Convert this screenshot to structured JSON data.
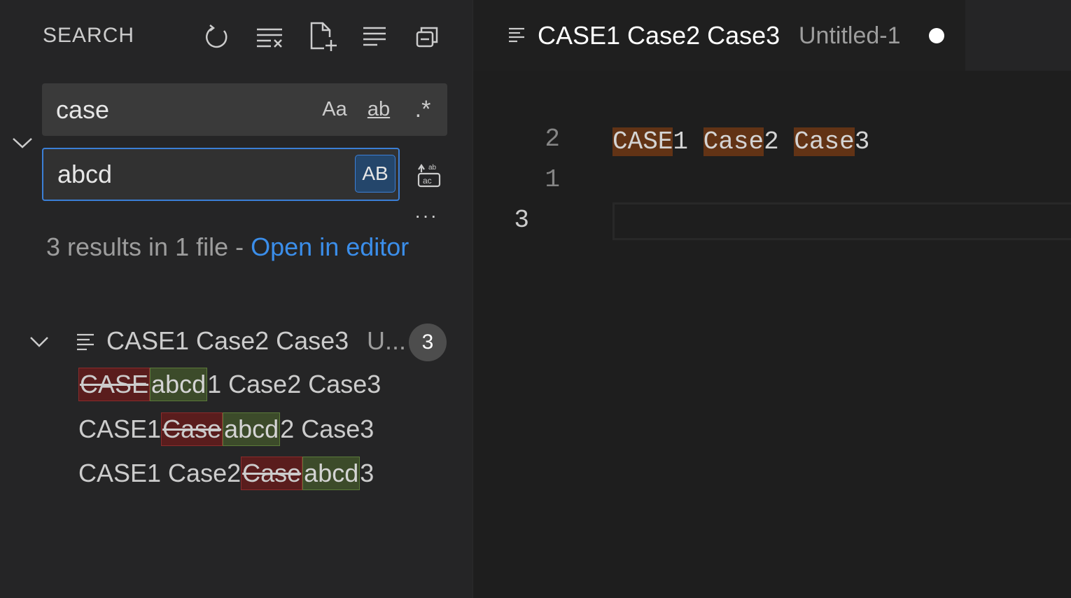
{
  "sidebar": {
    "title": "SEARCH",
    "toolbar": {
      "refresh": "refresh-icon",
      "clear": "clear-results-icon",
      "new_search_editor": "new-search-editor-icon",
      "view_as_tree": "view-as-list-icon",
      "collapse_all": "collapse-all-icon"
    },
    "search": {
      "value": "case",
      "match_case_label": "Aa",
      "whole_word_label": "ab",
      "regex_label": ".*"
    },
    "replace": {
      "value": "abcd",
      "preserve_case_label": "AB"
    },
    "more_label": "···",
    "summary": {
      "text": "3 results in 1 file - ",
      "link": "Open in editor"
    },
    "results": {
      "file_name": "CASE1 Case2 Case3",
      "file_desc": "U...",
      "count": "3",
      "matches": [
        {
          "before": "",
          "removed": "CASE",
          "added": "abcd",
          "after": "1 Case2 Case3"
        },
        {
          "before": "CASE1 ",
          "removed": "Case",
          "added": "abcd",
          "after": "2 Case3"
        },
        {
          "before": "CASE1 Case2 ",
          "removed": "Case",
          "added": "abcd",
          "after": "3"
        }
      ]
    }
  },
  "editor": {
    "tab": {
      "title": "CASE1 Case2 Case3",
      "desc": "Untitled-1"
    },
    "line_numbers": [
      "2",
      "1",
      "3"
    ],
    "code_line": {
      "t1": "CASE",
      "t1b": "1 ",
      "t2": "Case",
      "t2b": "2 ",
      "t3": "Case",
      "t3b": "3"
    }
  },
  "colors": {
    "accent": "#3b8eea",
    "focus_border": "#3b7fd6",
    "removed_bg": "#5a1d1d",
    "added_bg": "#3c4b2a",
    "find_highlight": "#623315"
  }
}
